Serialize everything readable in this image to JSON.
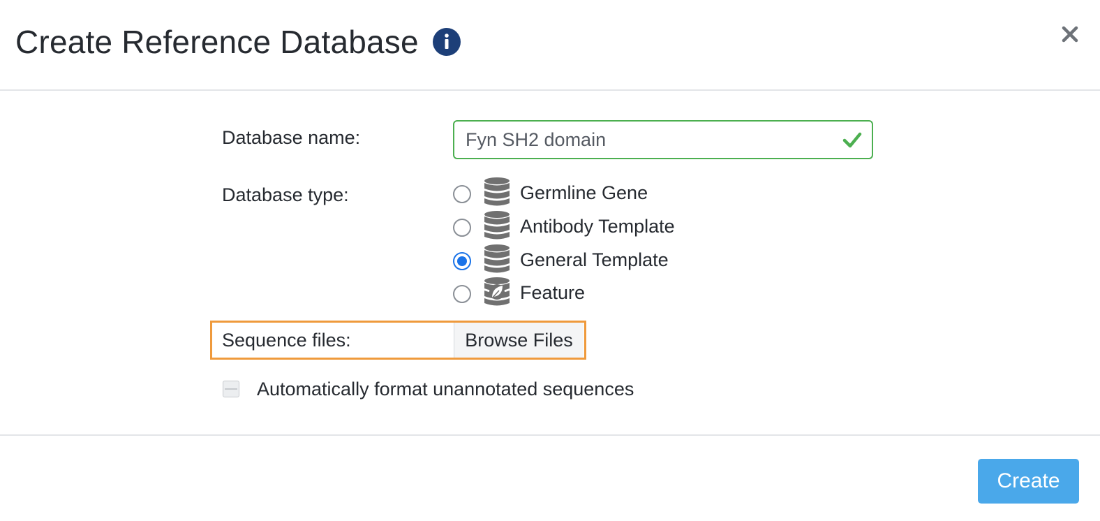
{
  "dialog": {
    "title": "Create Reference Database",
    "info_icon": "info-icon",
    "close_icon": "close-icon"
  },
  "form": {
    "name_label": "Database name:",
    "name_value": "Fyn SH2 domain",
    "name_valid": true,
    "type_label": "Database type:",
    "types": [
      {
        "label": "Germline Gene",
        "icon": "database-icon",
        "selected": false
      },
      {
        "label": "Antibody Template",
        "icon": "database-icon",
        "selected": false
      },
      {
        "label": "General Template",
        "icon": "database-icon",
        "selected": true
      },
      {
        "label": "Feature",
        "icon": "feature-database-icon",
        "selected": false
      }
    ],
    "sequence_label": "Sequence files:",
    "browse_label": "Browse Files",
    "auto_format_label": "Automatically format unannotated sequences",
    "auto_format_checked": false
  },
  "footer": {
    "create_label": "Create"
  },
  "colors": {
    "valid_border": "#4caf50",
    "highlight_border": "#ef9a3c",
    "primary_button": "#4aa8ea",
    "info_icon": "#1d3f78",
    "radio_selected": "#1a73e8"
  }
}
